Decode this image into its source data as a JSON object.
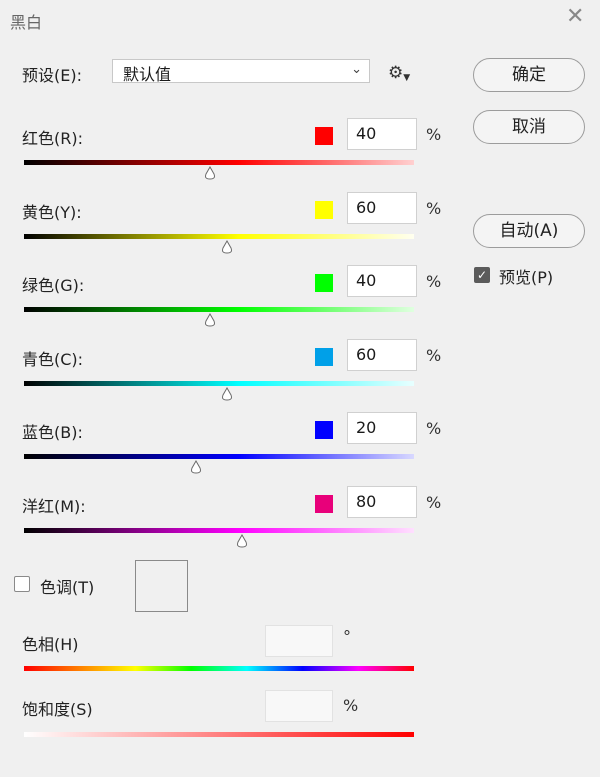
{
  "dialog": {
    "title": "黑白",
    "close_glyph": "✕"
  },
  "preset": {
    "label": "预设(E):",
    "value": "默认值",
    "gear_icon": "gear-icon"
  },
  "buttons": {
    "ok": "确定",
    "cancel": "取消",
    "auto": "自动(A)"
  },
  "preview": {
    "label": "预览(P)",
    "checked": true
  },
  "channels": [
    {
      "label": "红色(R):",
      "value": "40",
      "unit": "%",
      "swatch": "#ff0000",
      "gradient_end": "#ff0000",
      "gradient_tail": "#ffd0d0",
      "percent_position": 0.478
    },
    {
      "label": "黄色(Y):",
      "value": "60",
      "unit": "%",
      "swatch": "#ffff00",
      "gradient_end": "#ffff00",
      "gradient_tail": "#fffff0",
      "percent_position": 0.52
    },
    {
      "label": "绿色(G):",
      "value": "40",
      "unit": "%",
      "swatch": "#00ff00",
      "gradient_end": "#00ff00",
      "gradient_tail": "#e0ffe0",
      "percent_position": 0.478
    },
    {
      "label": "青色(C):",
      "value": "60",
      "unit": "%",
      "swatch": "#00a0e8",
      "gradient_end": "#00ffff",
      "gradient_tail": "#e8ffff",
      "percent_position": 0.52
    },
    {
      "label": "蓝色(B):",
      "value": "20",
      "unit": "%",
      "swatch": "#0000ff",
      "gradient_end": "#0000ff",
      "gradient_tail": "#d8d8ff",
      "percent_position": 0.44
    },
    {
      "label": "洋红(M):",
      "value": "80",
      "unit": "%",
      "swatch": "#e8007a",
      "gradient_end": "#ff00ff",
      "gradient_tail": "#ffe0ff",
      "percent_position": 0.558
    }
  ],
  "tint": {
    "label": "色调(T)",
    "checked": false
  },
  "hue": {
    "label": "色相(H)",
    "unit": "°"
  },
  "saturation": {
    "label": "饱和度(S)",
    "unit": "%"
  }
}
